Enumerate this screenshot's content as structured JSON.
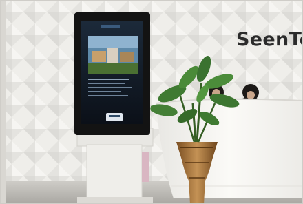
{
  "scene": {
    "brand_text": "SeenTe"
  },
  "colors": {
    "wall": "#efeeea",
    "kiosk_body": "#131313",
    "kiosk_stand": "#eaeae6",
    "counter": "#f5f4f0",
    "plant_leaf": "#3f7a32",
    "vase": "#a8773f"
  },
  "icons": [
    "kiosk-display",
    "potted-plant",
    "reception-counter",
    "receptionist"
  ]
}
